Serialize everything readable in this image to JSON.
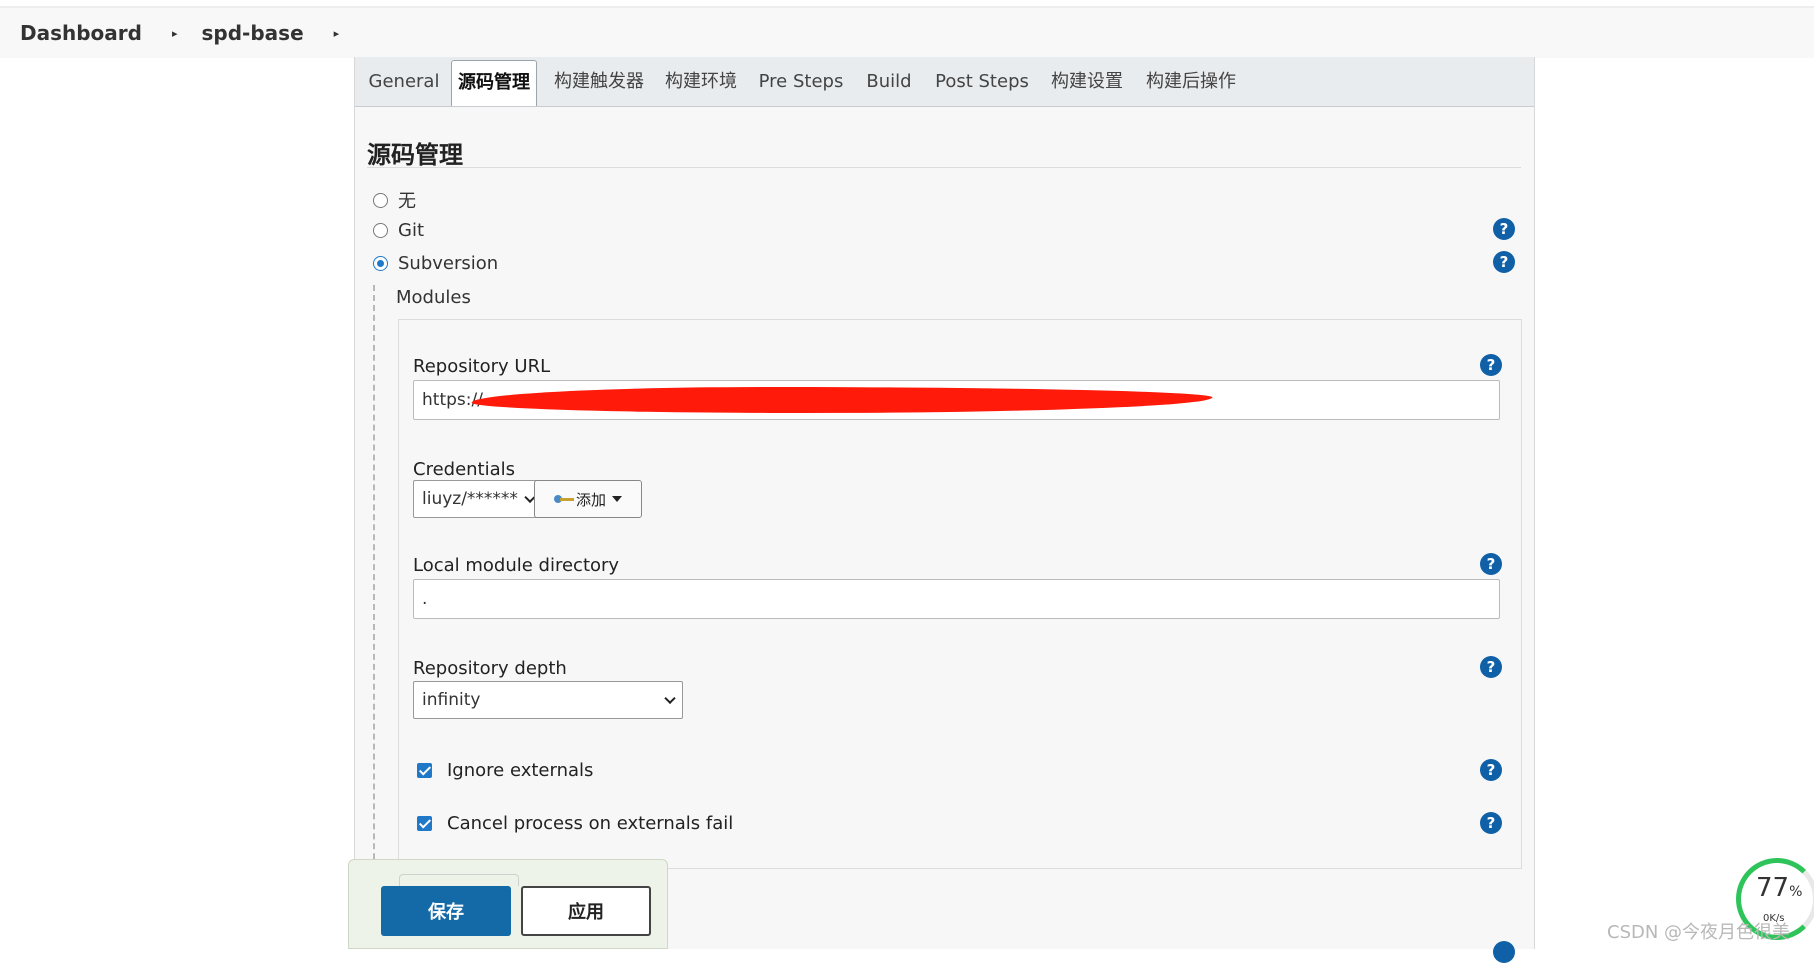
{
  "breadcrumb": {
    "items": [
      "Dashboard",
      "spd-base"
    ],
    "separator": "▸"
  },
  "tabs": [
    {
      "label": "General"
    },
    {
      "label": "源码管理"
    },
    {
      "label": "构建触发器"
    },
    {
      "label": "构建环境"
    },
    {
      "label": "Pre Steps"
    },
    {
      "label": "Build"
    },
    {
      "label": "Post Steps"
    },
    {
      "label": "构建设置"
    },
    {
      "label": "构建后操作"
    }
  ],
  "active_tab": "源码管理",
  "section": {
    "title": "源码管理",
    "scm_options": [
      {
        "label": "无",
        "selected": false
      },
      {
        "label": "Git",
        "selected": false
      },
      {
        "label": "Subversion",
        "selected": true
      }
    ]
  },
  "modules": {
    "label": "Modules",
    "repository_url_label": "Repository URL",
    "repository_url_value": "https://",
    "credentials_label": "Credentials",
    "credentials_selected": "liuyz/******",
    "add_button_label": "添加",
    "local_module_label": "Local module directory",
    "local_module_value": ".",
    "repository_depth_label": "Repository depth",
    "repository_depth_selected": "infinity",
    "ignore_externals_label": "Ignore externals",
    "ignore_externals_checked": true,
    "cancel_process_label": "Cancel process on externals fail",
    "cancel_process_checked": true
  },
  "help_icon_glyph": "?",
  "actions": {
    "save_label": "保存",
    "apply_label": "应用"
  },
  "gauge": {
    "percent": "77",
    "percent_unit": "%",
    "speed": "0K/s"
  },
  "watermark": "CSDN @今夜月色很美",
  "colors": {
    "primary_button": "#136aa6",
    "help_icon": "#1060a8",
    "checkbox": "#1f78c8",
    "redaction": "#ff1a0a",
    "gauge": "#2ec45a"
  }
}
